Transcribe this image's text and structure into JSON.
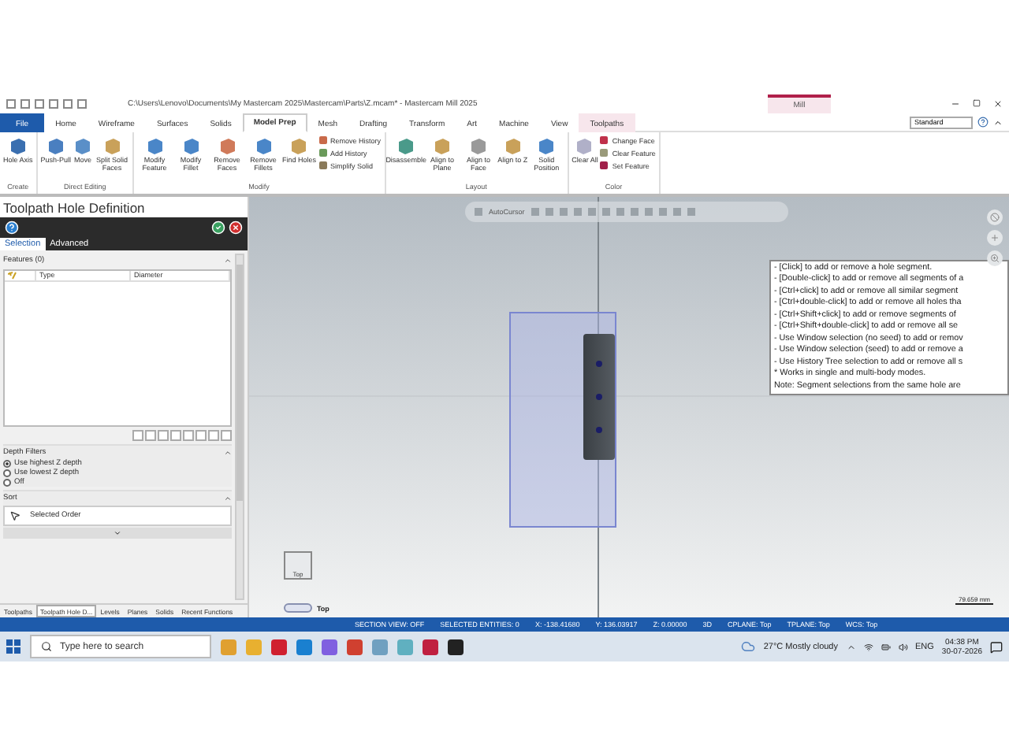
{
  "title_bar": {
    "title": "C:\\Users\\Lenovo\\Documents\\My Mastercam 2025\\Mastercam\\Parts\\Z.mcam* - Mastercam Mill 2025",
    "context_header": "Mill"
  },
  "ribbon_tabs": [
    {
      "label": "File",
      "selected": false,
      "kind": "file"
    },
    {
      "label": "Home",
      "selected": false,
      "kind": "tab"
    },
    {
      "label": "Wireframe",
      "selected": false,
      "kind": "tab"
    },
    {
      "label": "Surfaces",
      "selected": false,
      "kind": "tab"
    },
    {
      "label": "Solids",
      "selected": false,
      "kind": "tab"
    },
    {
      "label": "Model Prep",
      "selected": true,
      "kind": "tab"
    },
    {
      "label": "Mesh",
      "selected": false,
      "kind": "tab"
    },
    {
      "label": "Drafting",
      "selected": false,
      "kind": "tab"
    },
    {
      "label": "Transform",
      "selected": false,
      "kind": "tab"
    },
    {
      "label": "Art",
      "selected": false,
      "kind": "tab"
    },
    {
      "label": "Machine",
      "selected": false,
      "kind": "tab"
    },
    {
      "label": "View",
      "selected": false,
      "kind": "tab"
    },
    {
      "label": "Toolpaths",
      "selected": false,
      "kind": "context"
    }
  ],
  "workspace": "Standard",
  "ribbon_groups": [
    {
      "name": "Create",
      "buttons": [
        {
          "label": "Hole Axis",
          "kind": "large",
          "color": "#3a6fb0"
        }
      ]
    },
    {
      "name": "Direct Editing",
      "buttons": [
        {
          "label": "Push-Pull",
          "kind": "large",
          "color": "#4a7fc0"
        },
        {
          "label": "Move",
          "kind": "large",
          "color": "#5a8fc8"
        },
        {
          "label": "Split Solid Faces",
          "kind": "large",
          "color": "#c9a15a"
        }
      ]
    },
    {
      "name": "Modify",
      "buttons": [
        {
          "label": "Modify Feature",
          "kind": "large",
          "color": "#4a86c8"
        },
        {
          "label": "Modify Fillet",
          "kind": "large",
          "color": "#4a86c8"
        },
        {
          "label": "Remove Faces",
          "kind": "large",
          "color": "#d07a5a"
        },
        {
          "label": "Remove Fillets",
          "kind": "large",
          "color": "#4a86c8"
        },
        {
          "label": "Find Holes",
          "kind": "large",
          "color": "#c9a15a"
        },
        {
          "label": "Remove History",
          "kind": "small",
          "color": "#c96a4a"
        },
        {
          "label": "Add History",
          "kind": "small",
          "color": "#6a9a5a"
        },
        {
          "label": "Simplify Solid",
          "kind": "small",
          "color": "#8a7a5a"
        }
      ]
    },
    {
      "name": "Layout",
      "buttons": [
        {
          "label": "Disassemble",
          "kind": "large",
          "color": "#4a9a8a"
        },
        {
          "label": "Align to Plane",
          "kind": "large",
          "color": "#c9a15a"
        },
        {
          "label": "Align to Face",
          "kind": "large",
          "color": "#9a9a9a"
        },
        {
          "label": "Align to Z",
          "kind": "large",
          "color": "#c9a15a"
        },
        {
          "label": "Solid Position",
          "kind": "large",
          "color": "#4a86c8"
        }
      ]
    },
    {
      "name": "Color",
      "buttons": [
        {
          "label": "Clear All",
          "kind": "large",
          "color": "#b0b0c8"
        },
        {
          "label": "Change Face",
          "kind": "small",
          "color": "#c0304a"
        },
        {
          "label": "Clear Feature",
          "kind": "small",
          "color": "#9a9a7a"
        },
        {
          "label": "Set Feature",
          "kind": "small",
          "color": "#a0204a"
        }
      ]
    }
  ],
  "panel": {
    "title": "Toolpath Hole Definition",
    "tabs": [
      {
        "label": "Selection",
        "selected": true
      },
      {
        "label": "Advanced",
        "selected": false
      }
    ],
    "features_header": "Features (0)",
    "columns": [
      "Type",
      "Diameter"
    ],
    "depth_filters": {
      "header": "Depth Filters",
      "options": [
        {
          "label": "Use highest Z depth",
          "selected": true
        },
        {
          "label": "Use lowest Z depth",
          "selected": false
        },
        {
          "label": "Off",
          "selected": false
        }
      ]
    },
    "sort": {
      "header": "Sort",
      "value": "Selected Order"
    },
    "bottom_tabs": [
      {
        "label": "Toolpaths",
        "selected": false
      },
      {
        "label": "Toolpath Hole D...",
        "selected": true
      },
      {
        "label": "Levels",
        "selected": false
      },
      {
        "label": "Planes",
        "selected": false
      },
      {
        "label": "Solids",
        "selected": false
      },
      {
        "label": "Recent Functions",
        "selected": false
      }
    ]
  },
  "viewport": {
    "toolbar_label": "AutoCursor",
    "tooltip": [
      "- [Click] to add or remove a hole segment.",
      "- [Double-click] to add or remove all segments of a",
      "- [Ctrl+click] to add or remove all similar segment",
      "- [Ctrl+double-click] to add or remove all holes tha",
      "- [Ctrl+Shift+click] to add or remove segments of",
      "- [Ctrl+Shift+double-click] to add or remove all se",
      "- Use Window selection (no seed) to add or remov",
      "- Use Window selection (seed) to add or remove a",
      "- Use History Tree selection to add or remove all s",
      "* Works in single and multi-body modes.",
      "Note: Segment selections from the same hole are"
    ],
    "gnomon_label": "Top",
    "view_label": "Top",
    "scale": "79.659 mm"
  },
  "status_bar": [
    "SECTION VIEW: OFF",
    "SELECTED ENTITIES: 0",
    "X:  -138.41680",
    "Y:  136.03917",
    "Z:  0.00000",
    "3D",
    "CPLANE: Top",
    "TPLANE: Top",
    "WCS: Top"
  ],
  "taskbar": {
    "search_placeholder": "Type here to search",
    "weather": "27°C  Mostly cloudy",
    "language": "ENG",
    "time": "04:38 PM",
    "date": "30-07-2026"
  }
}
